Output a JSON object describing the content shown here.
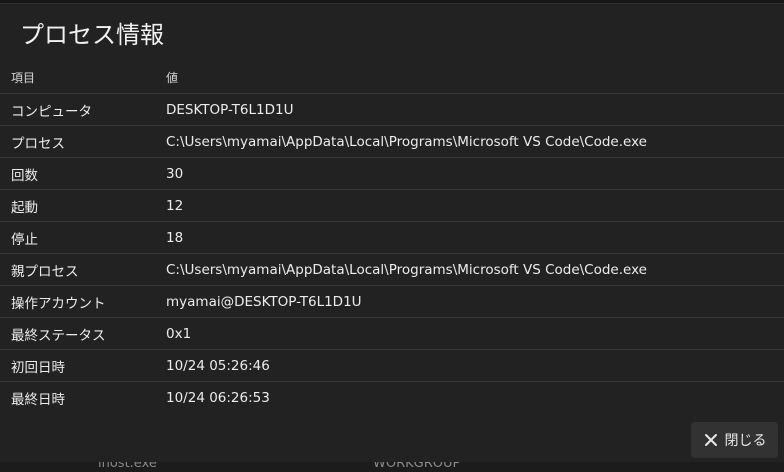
{
  "dialog": {
    "title": "プロセス情報",
    "header": {
      "col_item": "項目",
      "col_value": "値"
    },
    "rows": [
      {
        "label": "コンピュータ",
        "value": "DESKTOP-T6L1D1U"
      },
      {
        "label": "プロセス",
        "value": "C:\\Users\\myamai\\AppData\\Local\\Programs\\Microsoft VS Code\\Code.exe"
      },
      {
        "label": "回数",
        "value": "30"
      },
      {
        "label": "起動",
        "value": "12"
      },
      {
        "label": "停止",
        "value": "18"
      },
      {
        "label": "親プロセス",
        "value": "C:\\Users\\myamai\\AppData\\Local\\Programs\\Microsoft VS Code\\Code.exe"
      },
      {
        "label": "操作アカウント",
        "value": "myamai@DESKTOP-T6L1D1U"
      },
      {
        "label": "最終ステータス",
        "value": "0x1"
      },
      {
        "label": "初回日時",
        "value": "10/24 05:26:46"
      },
      {
        "label": "最終日時",
        "value": "10/24 06:26:53"
      }
    ],
    "close_label": "閉じる",
    "close_icon": "close-icon"
  },
  "background": {
    "left_text": "lhost.exe",
    "right_text": "WORKGROUP"
  }
}
